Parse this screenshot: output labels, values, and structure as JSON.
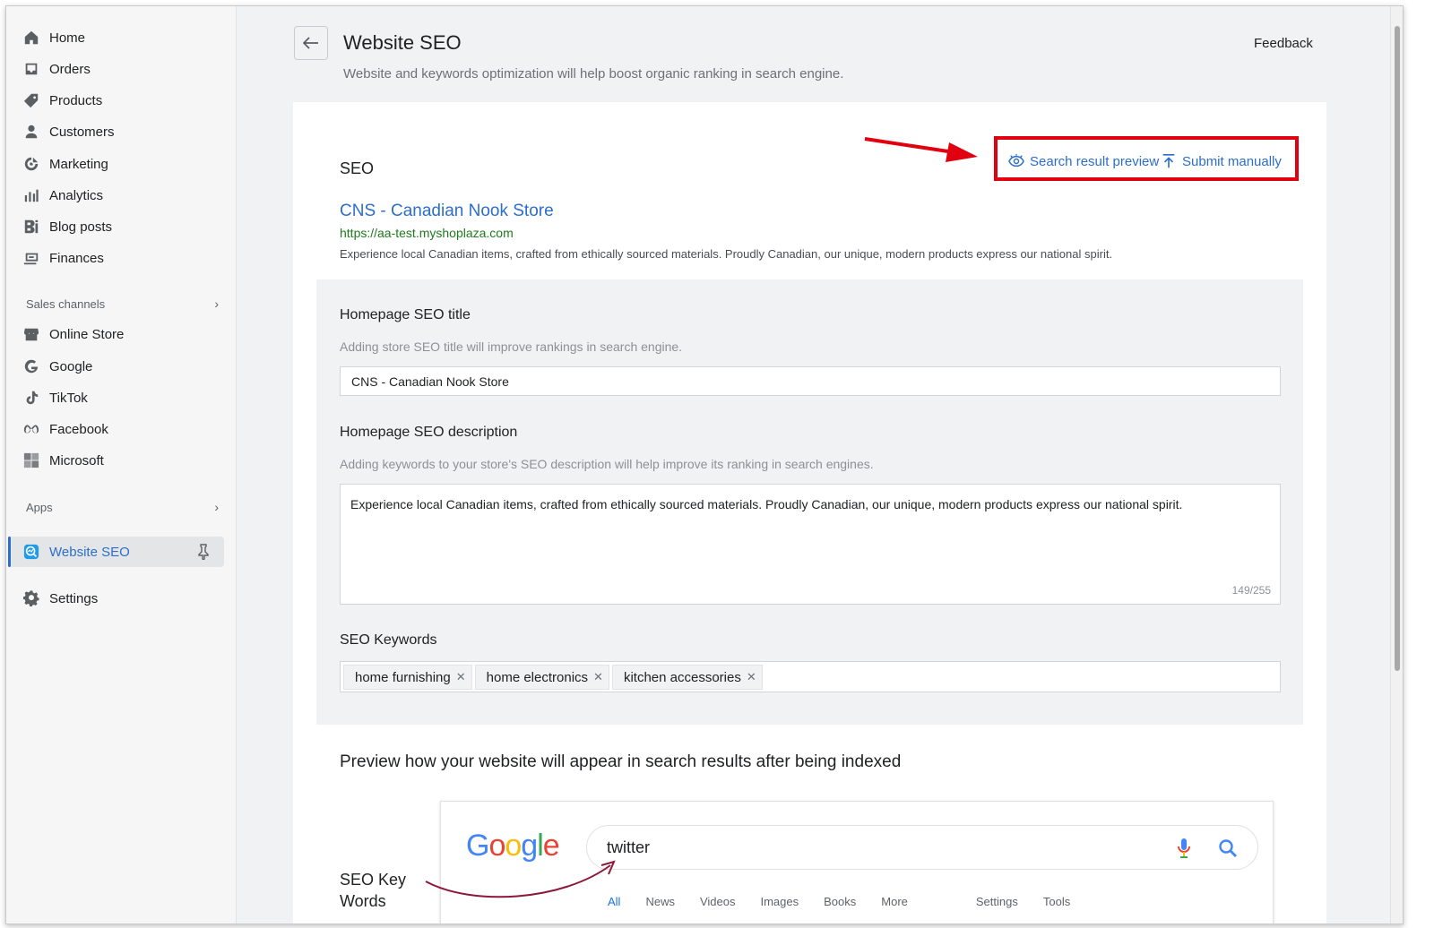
{
  "sidebar": {
    "items": [
      {
        "label": "Home",
        "icon": "home-icon"
      },
      {
        "label": "Orders",
        "icon": "orders-icon"
      },
      {
        "label": "Products",
        "icon": "tag-icon"
      },
      {
        "label": "Customers",
        "icon": "person-icon"
      },
      {
        "label": "Marketing",
        "icon": "target-icon"
      },
      {
        "label": "Analytics",
        "icon": "bar-chart-icon"
      },
      {
        "label": "Blog posts",
        "icon": "blog-icon"
      },
      {
        "label": "Finances",
        "icon": "finance-icon"
      }
    ],
    "sales_channels_label": "Sales channels",
    "channels": [
      {
        "label": "Online Store",
        "icon": "store-icon"
      },
      {
        "label": "Google",
        "icon": "google-icon"
      },
      {
        "label": "TikTok",
        "icon": "tiktok-icon"
      },
      {
        "label": "Facebook",
        "icon": "meta-icon"
      },
      {
        "label": "Microsoft",
        "icon": "microsoft-icon"
      }
    ],
    "apps_label": "Apps",
    "active_app": {
      "label": "Website SEO",
      "icon": "seo-app-icon"
    },
    "settings_label": "Settings"
  },
  "header": {
    "title": "Website SEO",
    "subtitle": "Website and keywords optimization will help boost organic ranking in search engine.",
    "feedback_label": "Feedback"
  },
  "seo": {
    "section_label": "SEO",
    "preview_label": "Search result preview",
    "submit_label": "Submit manually",
    "snippet": {
      "title": "CNS - Canadian Nook Store",
      "url": "https://aa-test.myshoplaza.com",
      "description": "Experience local Canadian items, crafted from ethically sourced materials. Proudly Canadian, our unique, modern products express our national spirit."
    },
    "title_field": {
      "label": "Homepage SEO title",
      "hint": "Adding store SEO title will improve rankings in search engine.",
      "value": "CNS - Canadian Nook Store"
    },
    "description_field": {
      "label": "Homepage SEO description",
      "hint": "Adding keywords to your store's SEO description will help improve its ranking in search engines.",
      "value": "Experience local Canadian items, crafted from ethically sourced materials. Proudly Canadian, our unique, modern products express our national spirit.",
      "counter": "149/255"
    },
    "keywords": {
      "label": "SEO Keywords",
      "tags": [
        "home furnishing",
        "home electronics",
        "kitchen accessories"
      ]
    }
  },
  "preview": {
    "heading": "Preview how your website will appear in search results after being indexed",
    "search_query": "twitter",
    "annotation_line1": "SEO Key",
    "annotation_line2": "Words",
    "tabs": [
      "All",
      "News",
      "Videos",
      "Images",
      "Books",
      "More",
      "Settings",
      "Tools"
    ]
  },
  "colors": {
    "accent": "#2c6ecb",
    "highlight": "#e0000f",
    "url_green": "#1e7a1e"
  }
}
